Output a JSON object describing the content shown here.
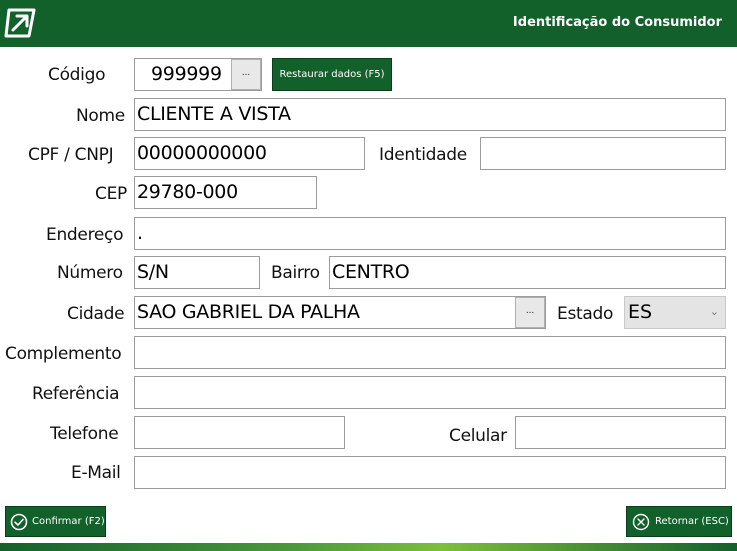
{
  "window": {
    "title": "Identificação do Consumidor"
  },
  "form": {
    "codigo_label": "Código",
    "codigo_value": "999999",
    "codigo_lookup": "...",
    "restore_button": "Restaurar dados (F5)",
    "nome_label": "Nome",
    "nome_value": "CLIENTE A VISTA",
    "cpf_label": "CPF / CNPJ",
    "cpf_value": "00000000000",
    "identidade_label": "Identidade",
    "identidade_value": "",
    "cep_label": "CEP",
    "cep_value": "29780-000",
    "endereco_label": "Endereço",
    "endereco_value": ".",
    "numero_label": "Número",
    "numero_value": "S/N",
    "bairro_label": "Bairro",
    "bairro_value": "CENTRO",
    "cidade_label": "Cidade",
    "cidade_value": "SAO GABRIEL DA PALHA",
    "cidade_lookup": "...",
    "estado_label": "Estado",
    "estado_value": "ES",
    "complemento_label": "Complemento",
    "complemento_value": "",
    "referencia_label": "Referência",
    "referencia_value": "",
    "telefone_label": "Telefone",
    "telefone_value": "",
    "celular_label": "Celular",
    "celular_value": "",
    "email_label": "E-Mail",
    "email_value": ""
  },
  "footer": {
    "confirm_button": "Confirmar (F2)",
    "return_button": "Retornar (ESC)"
  },
  "icons": {
    "logo": "arrow-logo-icon",
    "confirm": "check-circle-icon",
    "return": "x-circle-icon",
    "dropdown": "chevron-down-icon"
  },
  "colors": {
    "brand": "#12612b",
    "accent": "#7cbf3a"
  }
}
